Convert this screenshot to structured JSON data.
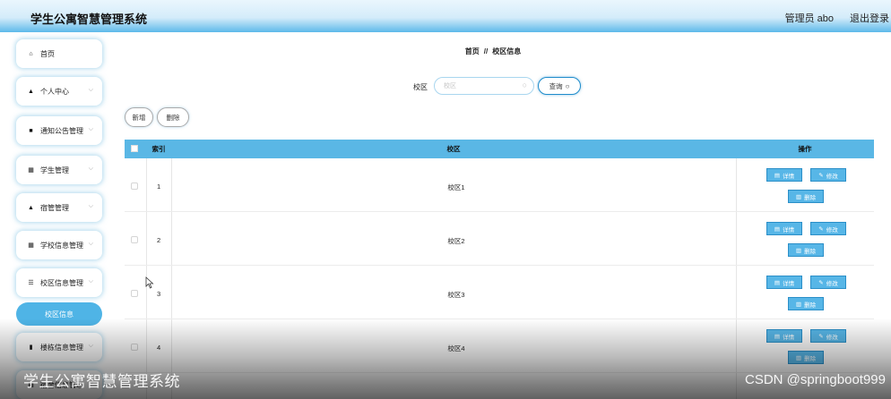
{
  "header": {
    "app_title": "学生公寓智慧管理系统",
    "user": "管理员 abo",
    "logout": "退出登录"
  },
  "sidebar": {
    "items": [
      {
        "label": "首页",
        "icon": "home-icon",
        "glyph": "⌂",
        "expandable": false
      },
      {
        "label": "个人中心",
        "icon": "person-icon",
        "glyph": "▲",
        "expandable": true
      },
      {
        "label": "通知公告管理",
        "icon": "notice-icon",
        "glyph": "■",
        "expandable": true
      },
      {
        "label": "学生管理",
        "icon": "grid-icon",
        "glyph": "▦",
        "expandable": true
      },
      {
        "label": "宿管管理",
        "icon": "person-icon",
        "glyph": "▲",
        "expandable": true
      },
      {
        "label": "学校信息管理",
        "icon": "grid-icon",
        "glyph": "▦",
        "expandable": true
      },
      {
        "label": "校区信息管理",
        "icon": "list-icon",
        "glyph": "☰",
        "expandable": true
      },
      {
        "label": "校区信息",
        "icon": "",
        "glyph": "",
        "active": true
      },
      {
        "label": "楼栋信息管理",
        "icon": "building-icon",
        "glyph": "▮",
        "expandable": true
      },
      {
        "label": "宿舍信息管理",
        "icon": "grid-icon",
        "glyph": "▦",
        "expandable": true
      }
    ]
  },
  "breadcrumb": {
    "home": "首页",
    "separator": "//",
    "current": "校区信息"
  },
  "search": {
    "label": "校区",
    "placeholder": "校区",
    "value": "",
    "button_label": "查询",
    "search_glyph": "○"
  },
  "toolbar": {
    "add_label": "新增",
    "delete_label": "删除"
  },
  "table": {
    "headers": {
      "index": "索引",
      "campus": "校区",
      "actions": "操作"
    },
    "rows": [
      {
        "index": "1",
        "campus": "校区1"
      },
      {
        "index": "2",
        "campus": "校区2"
      },
      {
        "index": "3",
        "campus": "校区3"
      },
      {
        "index": "4",
        "campus": "校区4"
      }
    ],
    "row_actions": {
      "detail": "详情",
      "edit": "修改",
      "delete": "删除"
    }
  },
  "watermark": {
    "left": "学生公寓智慧管理系统",
    "right": "CSDN @springboot999"
  },
  "colors": {
    "accent": "#5ab7e5",
    "header_gradient_end": "#5db9ea",
    "button_border": "#1f8ccb"
  }
}
